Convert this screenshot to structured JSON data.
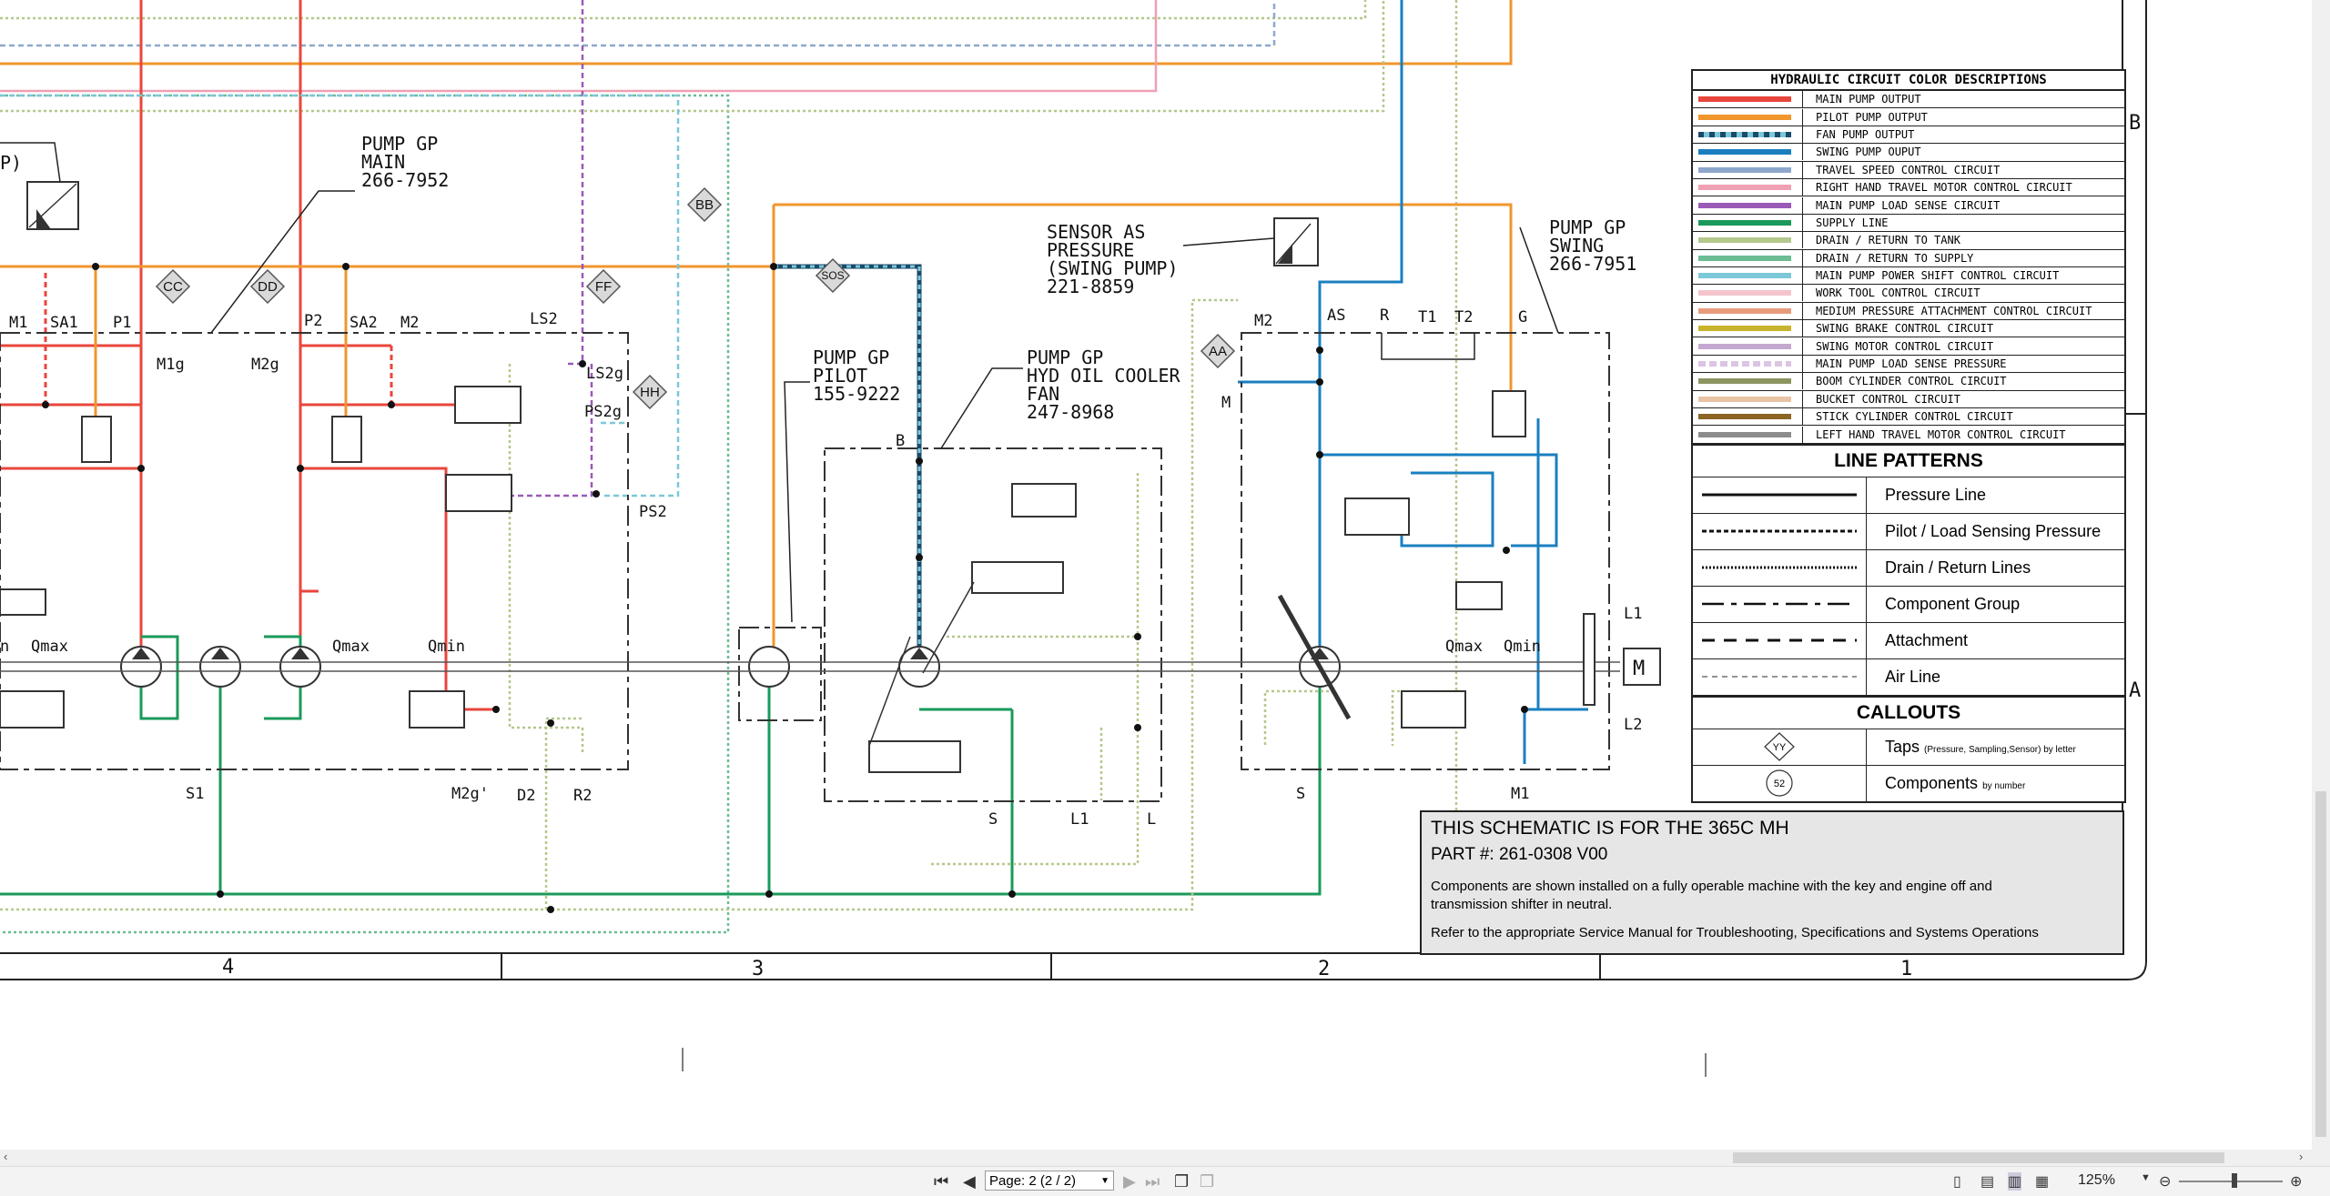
{
  "viewer": {
    "page_label": "Page: 2 (2 / 2)",
    "zoom": "125%"
  },
  "schematic": {
    "components": {
      "pump_main": {
        "l1": "PUMP GP",
        "l2": "MAIN",
        "l3": "266-7952"
      },
      "pump_pilot": {
        "l1": "PUMP GP",
        "l2": "PILOT",
        "l3": "155-9222"
      },
      "pump_fan": {
        "l1": "PUMP GP",
        "l2": "HYD OIL COOLER",
        "l3": "FAN",
        "l4": "247-8968"
      },
      "sensor": {
        "l1": "SENSOR AS",
        "l2": "PRESSURE",
        "l3": "(SWING PUMP)",
        "l4": "221-8859"
      },
      "pump_swing": {
        "l1": "PUMP GP",
        "l2": "SWING",
        "l3": "266-7951"
      },
      "partial_left": "P)"
    },
    "taps": [
      "CC",
      "DD",
      "FF",
      "HH",
      "BB",
      "SOS",
      "AA"
    ],
    "port_labels": [
      "M1",
      "SA1",
      "P1",
      "P2",
      "SA2",
      "M2",
      "LS2",
      "M1g",
      "M2g",
      "LS2g",
      "PS2g",
      "PS2",
      "Qmax",
      "Qmax",
      "Qmin",
      "S1",
      "M2g'",
      "D2",
      "R2",
      "B",
      "S",
      "L1",
      "L",
      "M2",
      "AS",
      "R",
      "T1",
      "T2",
      "G",
      "M",
      "L1",
      "L2",
      "M1",
      "S",
      "Qmax",
      "Qmin",
      "n"
    ],
    "zones": [
      "4",
      "3",
      "2",
      "1"
    ],
    "row_markers": [
      "B",
      "A"
    ]
  },
  "legend": {
    "color_title": "HYDRAULIC CIRCUIT COLOR DESCRIPTIONS",
    "colors": [
      {
        "label": "MAIN PUMP OUTPUT",
        "color": "#e8463c"
      },
      {
        "label": "PILOT PUMP OUTPUT",
        "color": "#f0962c"
      },
      {
        "label": "FAN PUMP OUTPUT",
        "color": "#4aa8c8"
      },
      {
        "label": "SWING PUMP OUPUT",
        "color": "#1a7fc0"
      },
      {
        "label": "TRAVEL SPEED CONTROL CIRCUIT",
        "color": "#8ea8cc"
      },
      {
        "label": "RIGHT HAND TRAVEL MOTOR CONTROL CIRCUIT",
        "color": "#f0a0b4"
      },
      {
        "label": "MAIN PUMP LOAD SENSE CIRCUIT",
        "color": "#9a5ab8"
      },
      {
        "label": "SUPPLY LINE",
        "color": "#1a9a5a"
      },
      {
        "label": "DRAIN / RETURN TO TANK",
        "color": "#b4c88c"
      },
      {
        "label": "DRAIN / RETURN TO SUPPLY",
        "color": "#6cbc94"
      },
      {
        "label": "MAIN PUMP POWER SHIFT CONTROL CIRCUIT",
        "color": "#7cc8d8"
      },
      {
        "label": "WORK TOOL CONTROL CIRCUIT",
        "color": "#f4c4cc"
      },
      {
        "label": "MEDIUM PRESSURE ATTACHMENT CONTROL CIRCUIT",
        "color": "#e89c7c"
      },
      {
        "label": "SWING BRAKE CONTROL CIRCUIT",
        "color": "#c8b42c"
      },
      {
        "label": "SWING MOTOR CONTROL CIRCUIT",
        "color": "#c4a8d0"
      },
      {
        "label": "MAIN PUMP LOAD SENSE PRESSURE",
        "color": "#dcc4e4"
      },
      {
        "label": "BOOM CYLINDER CONTROL CIRCUIT",
        "color": "#8c9460"
      },
      {
        "label": "BUCKET CONTROL CIRCUIT",
        "color": "#e8c4a4"
      },
      {
        "label": "STICK CYLINDER CONTROL CIRCUIT",
        "color": "#8c6424"
      },
      {
        "label": "LEFT HAND TRAVEL MOTOR CONTROL CIRCUIT",
        "color": "#8c8c8c"
      }
    ],
    "patterns_title": "LINE PATTERNS",
    "patterns": [
      "Pressure Line",
      "Pilot / Load Sensing Pressure",
      "Drain / Return Lines",
      "Component Group",
      "Attachment",
      "Air Line"
    ],
    "callouts_title": "CALLOUTS",
    "callout_taps_sym": "YY",
    "callout_taps": "Taps",
    "callout_taps_small": "(Pressure, Sampling,Sensor) by letter",
    "callout_comp_sym": "52",
    "callout_comp": "Components",
    "callout_comp_small": "by number"
  },
  "note": {
    "line1": "THIS SCHEMATIC IS FOR THE 365C MH",
    "line2": "PART #: 261-0308 V00",
    "line3": "Components are shown installed on a fully operable machine with the key and engine off and transmission shifter in neutral.",
    "line4": "Refer to the appropriate Service Manual for Troubleshooting, Specifications and Systems Operations"
  }
}
